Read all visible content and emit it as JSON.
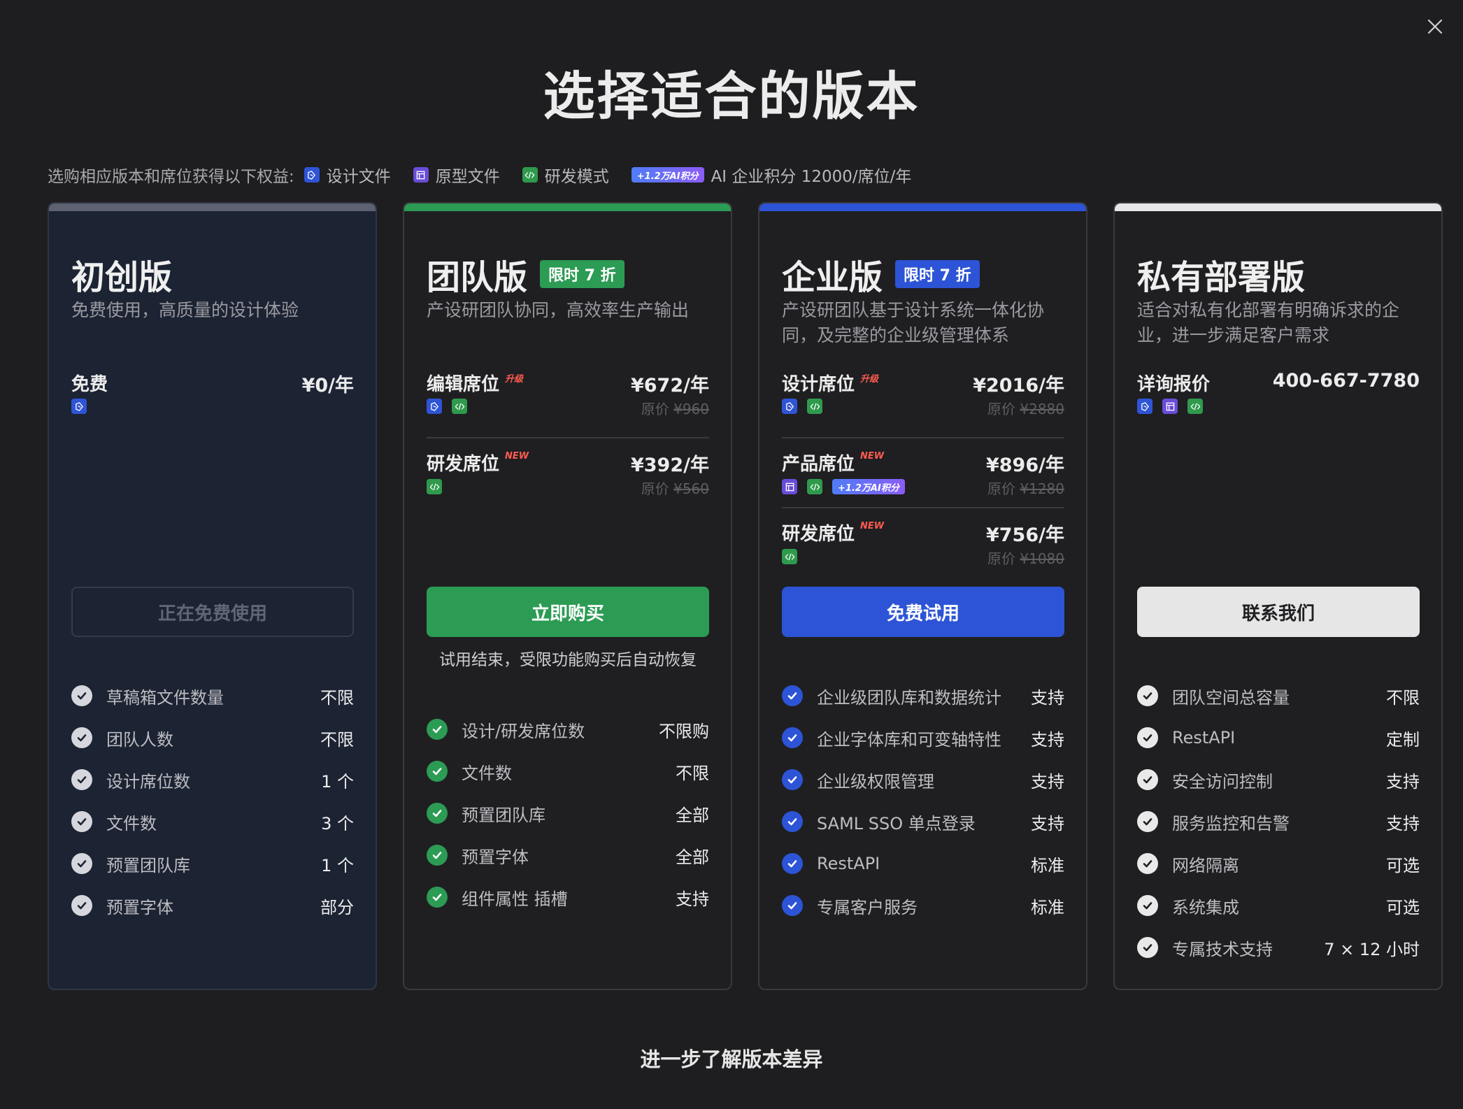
{
  "title": "选择适合的版本",
  "close_icon": "close-icon",
  "benefits": {
    "intro": "选购相应版本和席位获得以下权益:",
    "items": [
      {
        "icon": "design-file-icon",
        "label": "设计文件"
      },
      {
        "icon": "prototype-file-icon",
        "label": "原型文件"
      },
      {
        "icon": "dev-mode-icon",
        "label": "研发模式"
      }
    ],
    "ai_badge": "+1.2万AI积分",
    "ai_label": "AI 企业积分 12000/席位/年"
  },
  "colors": {
    "starter_bar": "#5d6170",
    "team_bar": "#2c9b54",
    "enterprise_bar": "#2d54d6",
    "private_bar": "#e6e6e6"
  },
  "plans": {
    "starter": {
      "name": "初创版",
      "desc": "免费使用，高质量的设计体验",
      "seats": [
        {
          "name": "免费",
          "price": "¥0/年"
        }
      ],
      "cta": "正在免费使用",
      "features": [
        {
          "label": "草稿箱文件数量",
          "value": "不限"
        },
        {
          "label": "团队人数",
          "value": "不限"
        },
        {
          "label": "设计席位数",
          "value": "1 个"
        },
        {
          "label": "文件数",
          "value": "3 个"
        },
        {
          "label": "预置团队库",
          "value": "1 个"
        },
        {
          "label": "预置字体",
          "value": "部分"
        }
      ]
    },
    "team": {
      "name": "团队版",
      "badge": "限时 7 折",
      "desc": "产设研团队协同，高效率生产输出",
      "seats": [
        {
          "name": "编辑席位",
          "flag": "升级",
          "price": "¥672/年",
          "orig_prefix": "原价 ",
          "orig": "¥960"
        },
        {
          "name": "研发席位",
          "flag": "NEW",
          "price": "¥392/年",
          "orig_prefix": "原价 ",
          "orig": "¥560"
        }
      ],
      "cta": "立即购买",
      "cta_note": "试用结束，受限功能购买后自动恢复",
      "features": [
        {
          "label": "设计/研发席位数",
          "value": "不限购"
        },
        {
          "label": "文件数",
          "value": "不限"
        },
        {
          "label": "预置团队库",
          "value": "全部"
        },
        {
          "label": "预置字体",
          "value": "全部"
        },
        {
          "label": "组件属性 插槽",
          "value": "支持"
        }
      ]
    },
    "enterprise": {
      "name": "企业版",
      "badge": "限时 7 折",
      "desc": "产设研团队基于设计系统一体化协同，及完整的企业级管理体系",
      "seats": [
        {
          "name": "设计席位",
          "flag": "升级",
          "price": "¥2016/年",
          "orig_prefix": "原价 ",
          "orig": "¥2880"
        },
        {
          "name": "产品席位",
          "flag": "NEW",
          "price": "¥896/年",
          "orig_prefix": "原价 ",
          "orig": "¥1280",
          "ai_badge": "+1.2万AI积分"
        },
        {
          "name": "研发席位",
          "flag": "NEW",
          "price": "¥756/年",
          "orig_prefix": "原价 ",
          "orig": "¥1080"
        }
      ],
      "cta": "免费试用",
      "features": [
        {
          "label": "企业级团队库和数据统计",
          "value": "支持"
        },
        {
          "label": "企业字体库和可变轴特性",
          "value": "支持"
        },
        {
          "label": "企业级权限管理",
          "value": "支持"
        },
        {
          "label": "SAML SSO 单点登录",
          "value": "支持"
        },
        {
          "label": "RestAPI",
          "value": "标准"
        },
        {
          "label": "专属客户服务",
          "value": "标准"
        }
      ]
    },
    "private": {
      "name": "私有部署版",
      "desc": "适合对私有化部署有明确诉求的企业，进一步满足客户需求",
      "seats": [
        {
          "name": "详询报价",
          "price": "400-667-7780"
        }
      ],
      "cta": "联系我们",
      "features": [
        {
          "label": "团队空间总容量",
          "value": "不限"
        },
        {
          "label": "RestAPI",
          "value": "定制"
        },
        {
          "label": "安全访问控制",
          "value": "支持"
        },
        {
          "label": "服务监控和告警",
          "value": "支持"
        },
        {
          "label": "网络隔离",
          "value": "可选"
        },
        {
          "label": "系统集成",
          "value": "可选"
        },
        {
          "label": "专属技术支持",
          "value": "7 × 12 小时"
        }
      ]
    }
  },
  "compare_link": "进一步了解版本差异"
}
